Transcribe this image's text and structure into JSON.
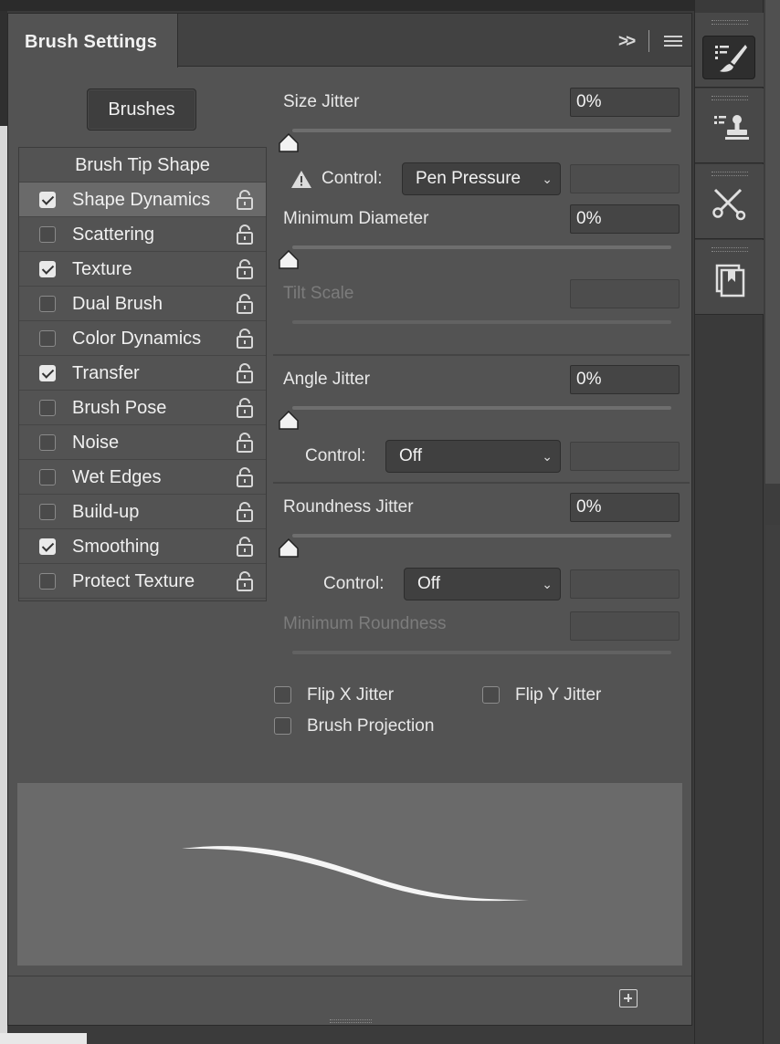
{
  "panel": {
    "title": "Brush Settings",
    "brushes_button": "Brushes"
  },
  "options": {
    "header": "Brush Tip Shape",
    "items": [
      {
        "label": "Shape Dynamics",
        "checked": true,
        "selected": true
      },
      {
        "label": "Scattering",
        "checked": false
      },
      {
        "label": "Texture",
        "checked": true
      },
      {
        "label": "Dual Brush",
        "checked": false
      },
      {
        "label": "Color Dynamics",
        "checked": false
      },
      {
        "label": "Transfer",
        "checked": true
      },
      {
        "label": "Brush Pose",
        "checked": false
      },
      {
        "label": "Noise",
        "checked": false
      },
      {
        "label": "Wet Edges",
        "checked": false
      },
      {
        "label": "Build-up",
        "checked": false
      },
      {
        "label": "Smoothing",
        "checked": true
      },
      {
        "label": "Protect Texture",
        "checked": false
      }
    ]
  },
  "settings": {
    "size_jitter": {
      "label": "Size Jitter",
      "value": "0%"
    },
    "control_1": {
      "label": "Control:",
      "value": "Pen Pressure"
    },
    "min_diameter": {
      "label": "Minimum Diameter",
      "value": "0%"
    },
    "tilt_scale": {
      "label": "Tilt Scale"
    },
    "angle_jitter": {
      "label": "Angle Jitter",
      "value": "0%"
    },
    "control_2": {
      "label": "Control:",
      "value": "Off"
    },
    "roundness_jitter": {
      "label": "Roundness Jitter",
      "value": "0%"
    },
    "control_3": {
      "label": "Control:",
      "value": "Off"
    },
    "min_roundness": {
      "label": "Minimum Roundness"
    },
    "flip_x": {
      "label": "Flip X Jitter",
      "checked": false
    },
    "flip_y": {
      "label": "Flip Y Jitter",
      "checked": false
    },
    "projection": {
      "label": "Brush Projection",
      "checked": false
    }
  },
  "icons": {
    "collapse": "double-chevron-right-icon",
    "menu": "hamburger-menu-icon",
    "warning": "warning-icon",
    "lock": "lock-icon",
    "new": "new-preset-icon"
  },
  "colors": {
    "panel_bg": "#535353",
    "selected_row": "#6a6a6a",
    "field_bg": "#454545",
    "preview_bg": "#6a6a6a"
  }
}
